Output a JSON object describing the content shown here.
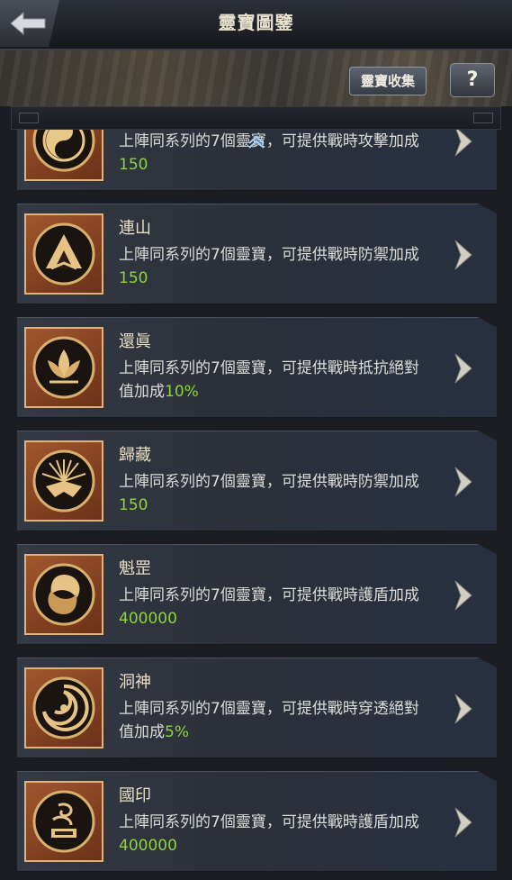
{
  "header": {
    "title": "靈寶圖鑒",
    "collect_label": "靈寶收集",
    "help_label": "?"
  },
  "cards": [
    {
      "title": "",
      "desc_pre": "上陣同系列的7個靈寶，可提供戰時攻擊加成",
      "value": "150",
      "icon": "yin-yang-icon"
    },
    {
      "title": "連山",
      "desc_pre": "上陣同系列的7個靈寶，可提供戰時防禦加成",
      "value": "150",
      "icon": "mountain-icon"
    },
    {
      "title": "還眞",
      "desc_pre": "上陣同系列的7個靈寶，可提供戰時抵抗絕對值加成",
      "value": "10%",
      "icon": "lotus-icon"
    },
    {
      "title": "歸藏",
      "desc_pre": "上陣同系列的7個靈寶，可提供戰時防禦加成",
      "value": "150",
      "icon": "sunburst-icon"
    },
    {
      "title": "魁罡",
      "desc_pre": "上陣同系列的7個靈寶，可提供戰時護盾加成",
      "value": "400000",
      "icon": "swirl-icon"
    },
    {
      "title": "洞神",
      "desc_pre": "上陣同系列的7個靈寶，可提供戰時穿透絕對值加成",
      "value": "5%",
      "icon": "vortex-icon"
    },
    {
      "title": "國印",
      "desc_pre": "上陣同系列的7個靈寶，可提供戰時護盾加成",
      "value": "400000",
      "icon": "dragon-seal-icon"
    }
  ]
}
